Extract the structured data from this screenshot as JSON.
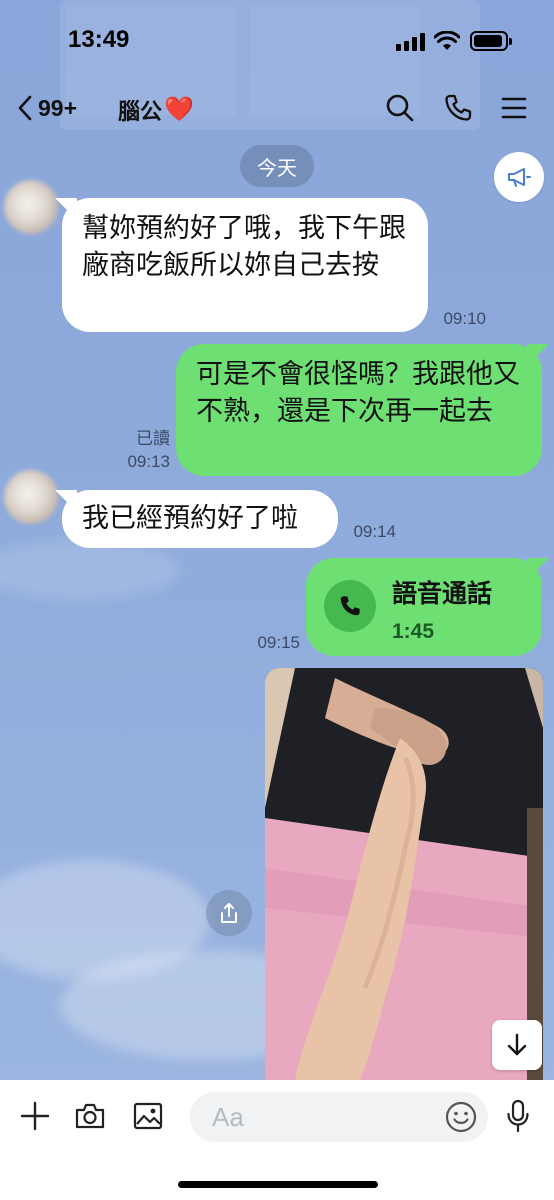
{
  "status_bar": {
    "time": "13:49"
  },
  "header": {
    "back_count": "99+",
    "title": "腦公",
    "title_emoji": "❤️"
  },
  "date_divider": "今天",
  "messages": [
    {
      "direction": "in",
      "text": "幫妳預約好了哦，我下午跟廠商吃飯所以妳自己去按",
      "time": "09:10"
    },
    {
      "direction": "out",
      "text": "可是不會很怪嗎？我跟他又不熟，還是下次再一起去",
      "read_label": "已讀",
      "time": "09:13"
    },
    {
      "direction": "in",
      "text": "我已經預約好了啦",
      "time": "09:14"
    },
    {
      "direction": "out",
      "type": "voice_call",
      "title": "語音通話",
      "duration": "1:45",
      "time": "09:15"
    },
    {
      "direction": "out",
      "type": "photo"
    }
  ],
  "input_bar": {
    "placeholder": "Aa"
  },
  "colors": {
    "chat_background": "#8eaadb",
    "outgoing_bubble": "#6ddf73",
    "incoming_bubble": "#ffffff",
    "heart": "#e8212f"
  }
}
